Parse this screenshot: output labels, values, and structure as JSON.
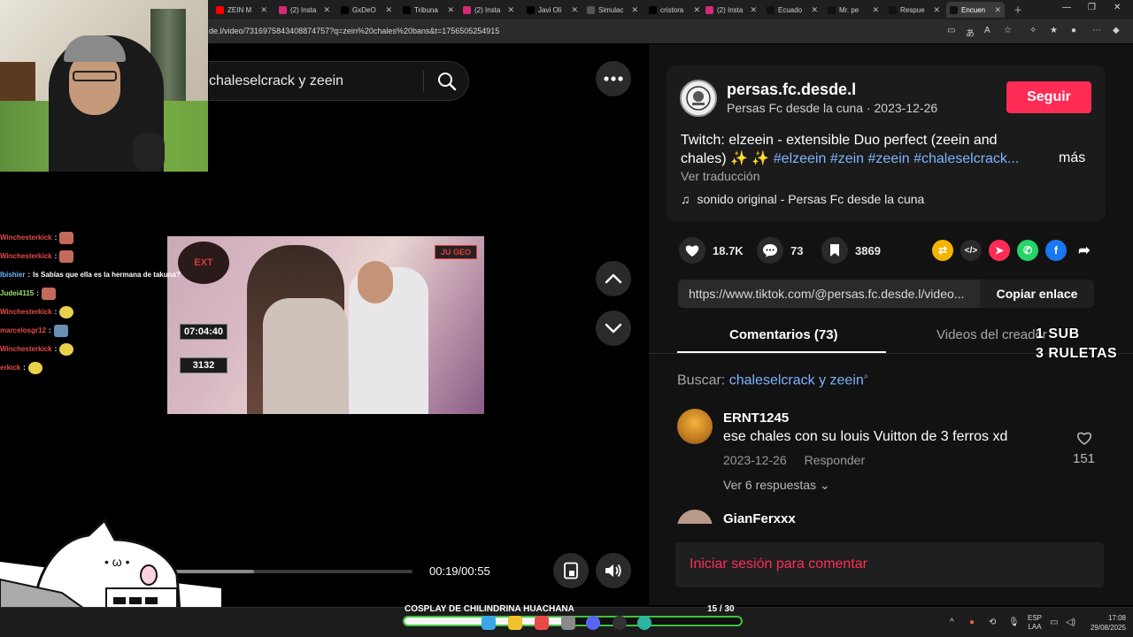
{
  "browser": {
    "tabs": [
      {
        "title": "ZEIN M",
        "icon": "youtube-icon",
        "color": "#ff0000"
      },
      {
        "title": "(2) Insta",
        "icon": "instagram-icon",
        "color": "#d62976"
      },
      {
        "title": "GxDeO",
        "icon": "x-icon",
        "color": "#000000"
      },
      {
        "title": "Tribuna",
        "icon": "x-icon",
        "color": "#000000"
      },
      {
        "title": "(2) Insta",
        "icon": "instagram-icon",
        "color": "#d62976"
      },
      {
        "title": "Javi Oli",
        "icon": "x-icon",
        "color": "#000000"
      },
      {
        "title": "Simulac",
        "icon": "globe-icon",
        "color": "#555555"
      },
      {
        "title": "cristora",
        "icon": "x-icon",
        "color": "#000000"
      },
      {
        "title": "(2) Insta",
        "icon": "instagram-icon",
        "color": "#d62976"
      },
      {
        "title": "Ecuado",
        "icon": "tiktok-icon",
        "color": "#111111"
      },
      {
        "title": "Mr. pe",
        "icon": "tiktok-icon",
        "color": "#111111"
      },
      {
        "title": "Respue",
        "icon": "tiktok-icon",
        "color": "#111111"
      },
      {
        "title": "Encuen",
        "icon": "tiktok-icon",
        "color": "#111111"
      }
    ],
    "url": "de.l/video/7316975843408874757?q=zein%20chales%20bans&t=1756505254915"
  },
  "chat": [
    {
      "user": "Winchesterkick",
      "msg": "",
      "emote": "face"
    },
    {
      "user": "Winchesterkick",
      "msg": "",
      "emote": "face"
    },
    {
      "user": "Ibishier",
      "msg": "Is Sabías que ella es la hermana de takuna?",
      "emote": "",
      "user_color": "#6bb8ff"
    },
    {
      "user": "Judei4115",
      "msg": "",
      "emote": "face",
      "user_color": "#9be36b"
    },
    {
      "user": "Winchesterkick",
      "msg": "",
      "emote": "pepe"
    },
    {
      "user": "marcelosgr12",
      "msg": "",
      "emote": "bird",
      "user_color": "#e64b4b"
    },
    {
      "user": "Winchesterkick",
      "msg": "",
      "emote": "pepe"
    },
    {
      "user": "erkick",
      "msg": "",
      "emote": "pepe"
    }
  ],
  "player": {
    "search_text": "chaleselcrack y zeein",
    "overlay_logo": "EXT",
    "overlay_badge": "JU GEO",
    "timer": "07:04:40",
    "counter": "3132",
    "progress_fraction": 0.35,
    "time": "00:19/00:55"
  },
  "video": {
    "author_handle": "persas.fc.desde.l",
    "author_name": "Persas Fc desde la cuna",
    "date": "2023-12-26",
    "author_line": "Persas Fc desde la cuna · 2023-12-26",
    "follow_label": "Seguir",
    "description": "Twitch: elzeein - extensible Duo perfect (zeein and chales) ✨ ✨ ",
    "hashtags": "#elzeein #zein #zeein #chaleselcrack...",
    "more_label": "más",
    "translate_label": "Ver traducción",
    "sound": "sonido original - Persas Fc desde la cuna",
    "likes": "18.7K",
    "comments": "73",
    "saves": "3869",
    "link_url": "https://www.tiktok.com/@persas.fc.desde.l/video...",
    "copy_label": "Copiar enlace"
  },
  "tabs": {
    "comments": "Comentarios (73)",
    "creator_videos": "Videos del creador"
  },
  "overlay_text": {
    "line1": "1 SUB",
    "line2": "3 RULETAS"
  },
  "related_search": {
    "label": "Buscar:",
    "keyword": "chaleselcrack y zeein"
  },
  "comments": [
    {
      "user": "ERNT1245",
      "text": "ese chales con su louis Vuitton de 3 ferros xd",
      "date": "2023-12-26",
      "reply_label": "Responder",
      "replies": "Ver 6 respuestas",
      "likes": "151"
    },
    {
      "user": "GianFerxxx"
    }
  ],
  "login_prompt": "Iniciar sesión para comentar",
  "taskbar": {
    "goal_label": "COSPLAY DE CHILINDRINA HUACHANA",
    "goal_count": "15  / 30",
    "goal_fraction": 0.5,
    "lang_1": "ESP",
    "lang_2": "LAA",
    "time": "17:08",
    "date": "29/08/2025"
  },
  "colors": {
    "accent": "#fe2c55",
    "hashtag": "#7fb3ff",
    "panel_bg": "#121212",
    "card_bg": "#1b1b1b"
  }
}
